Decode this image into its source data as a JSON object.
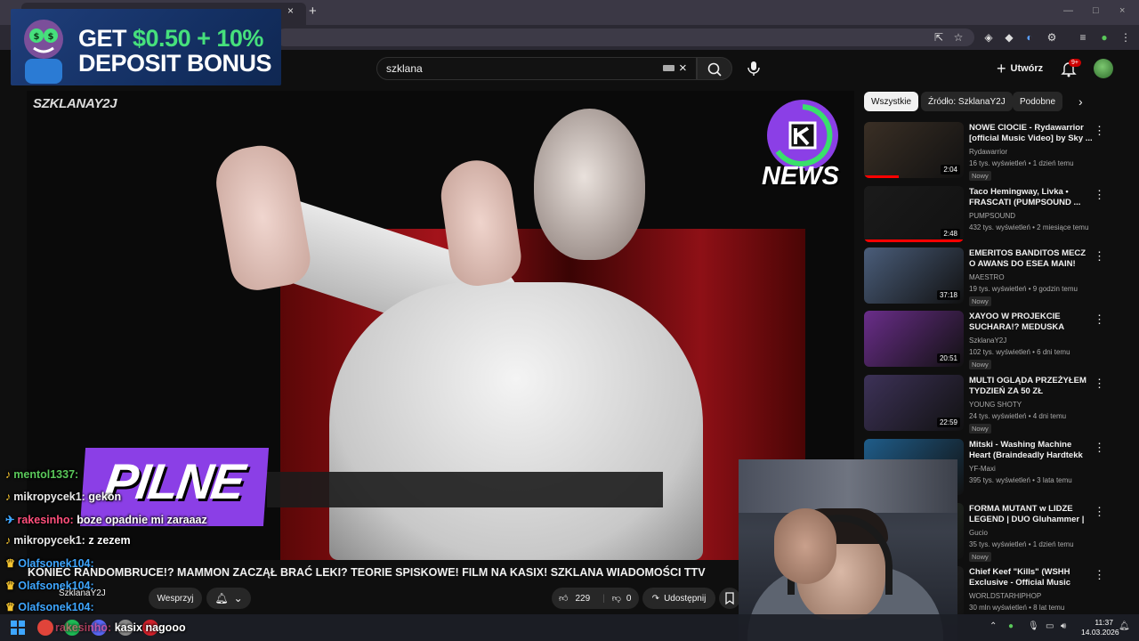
{
  "browser": {
    "tab_close": "×",
    "new_tab": "+"
  },
  "promo": {
    "line1_prefix": "GET ",
    "line1_amount": "$0.50 + 10%",
    "line2": "DEPOSIT BONUS",
    "colors": {
      "bg": "#143063",
      "accent": "#46e07c"
    }
  },
  "header": {
    "search_value": "szklana",
    "clear_icon": "×",
    "create_label": "Utwórz",
    "notifications_badge": "9+"
  },
  "video": {
    "watermark": "SZKLANAY2J",
    "news_logo_text": "NEWS",
    "pilne_text": "PILNE",
    "title": "KONIEC RANDOMBRUCE!? MAMMON ZACZĄŁ BRAĆ LEKI? TEORIE SPISKOWE! FILM NA KASIX! SZKLANA WIADOMOŚCI TTV",
    "channel": "SzklanaY2J",
    "support_label": "Wesprzyj",
    "likes": "229",
    "dislikes": "0",
    "share_label": "Udostępnij"
  },
  "chat": [
    {
      "user": "mentol1337:",
      "msg": "",
      "style": "green",
      "icon": "♪"
    },
    {
      "user": "mikropycek1:",
      "msg": "gekon",
      "style": "mod",
      "icon": "♪"
    },
    {
      "user": "rakesinho:",
      "msg": "boze opadnie mi zaraaaz",
      "style": "pink",
      "icon": "✈"
    },
    {
      "user": "mikropycek1:",
      "msg": "z zezem",
      "style": "mod",
      "icon": "♪"
    },
    {
      "user": "Olafsonek104:",
      "msg": "",
      "style": "blue",
      "icon": "♛"
    },
    {
      "user": "Olafsonek104:",
      "msg": "",
      "style": "blue",
      "icon": "♛"
    },
    {
      "user": "Olafsonek104:",
      "msg": "",
      "style": "blue",
      "icon": "♛"
    },
    {
      "user": "rakesinho:",
      "msg": "kasix nagooo",
      "style": "pink",
      "icon": "✈"
    }
  ],
  "sidebar": {
    "chips": [
      "Wszystkie",
      "Źródło: SzklanaY2J",
      "Podobne"
    ],
    "recommendations": [
      {
        "title": "NOWE CIOCIE - Rydawarrior [official Music Video] by Sky ...",
        "channel": "Rydawarrior",
        "meta": "16 tys. wyświetleń • 1 dzień temu",
        "badge": "Nowy",
        "duration": "2:04",
        "progress": 0.35,
        "thumb_color": "#3a2f25"
      },
      {
        "title": "Taco Hemingway, Livka • FRASCATI (PUMPSOUND ...",
        "channel": "PUMPSOUND",
        "meta": "432 tys. wyświetleń • 2 miesiące temu",
        "badge": "",
        "duration": "2:48",
        "progress": 1.0,
        "thumb_color": "#1b1b1b"
      },
      {
        "title": "EMERITOS BANDITOS MECZ O AWANS DO ESEA MAIN!",
        "channel": "MAESTRO",
        "meta": "19 tys. wyświetleń • 9 godzin temu",
        "badge": "Nowy",
        "duration": "37:18",
        "progress": 0,
        "thumb_color": "#4a5d7a"
      },
      {
        "title": "XAYOO W PROJEKCIE SUCHARA!? MEDUSKA STREA...",
        "channel": "SzklanaY2J",
        "meta": "102 tys. wyświetleń • 6 dni temu",
        "badge": "Nowy",
        "duration": "20:51",
        "progress": 0,
        "thumb_color": "#6a2d8a"
      },
      {
        "title": "MULTI OGLĄDA PRZEŻYŁEM TYDZIEŃ ZA 50 ZŁ",
        "channel": "YOUNG SHOTY",
        "meta": "24 tys. wyświetleń • 4 dni temu",
        "badge": "Nowy",
        "duration": "22:59",
        "progress": 0,
        "thumb_color": "#3d3258"
      },
      {
        "title": "Mitski - Washing Machine Heart (Braindeadly Hardtekk Remix)",
        "channel": "YF-Maxi",
        "meta": "395 tys. wyświetleń • 3 lata temu",
        "badge": "",
        "duration": "",
        "progress": 0,
        "thumb_color": "#1f5d8a"
      },
      {
        "title": "FORMA MUTANT w LIDZE LEGEND | DUO Gluhammer |",
        "channel": "Gucio",
        "meta": "35 tys. wyświetleń • 1 dzień temu",
        "badge": "Nowy",
        "duration": "",
        "progress": 0,
        "thumb_color": "#2d3a2d"
      },
      {
        "title": "Chief Keef \"Kills\" (WSHH Exclusive - Official Music Video)",
        "channel": "WORLDSTARHIPHOP",
        "meta": "30 mln wyświetleń • 8 lat temu",
        "badge": "",
        "duration": "",
        "progress": 0,
        "thumb_color": "#2a2a2a"
      }
    ]
  },
  "taskbar": {
    "time": "11:37",
    "date": "14.03.2026"
  }
}
